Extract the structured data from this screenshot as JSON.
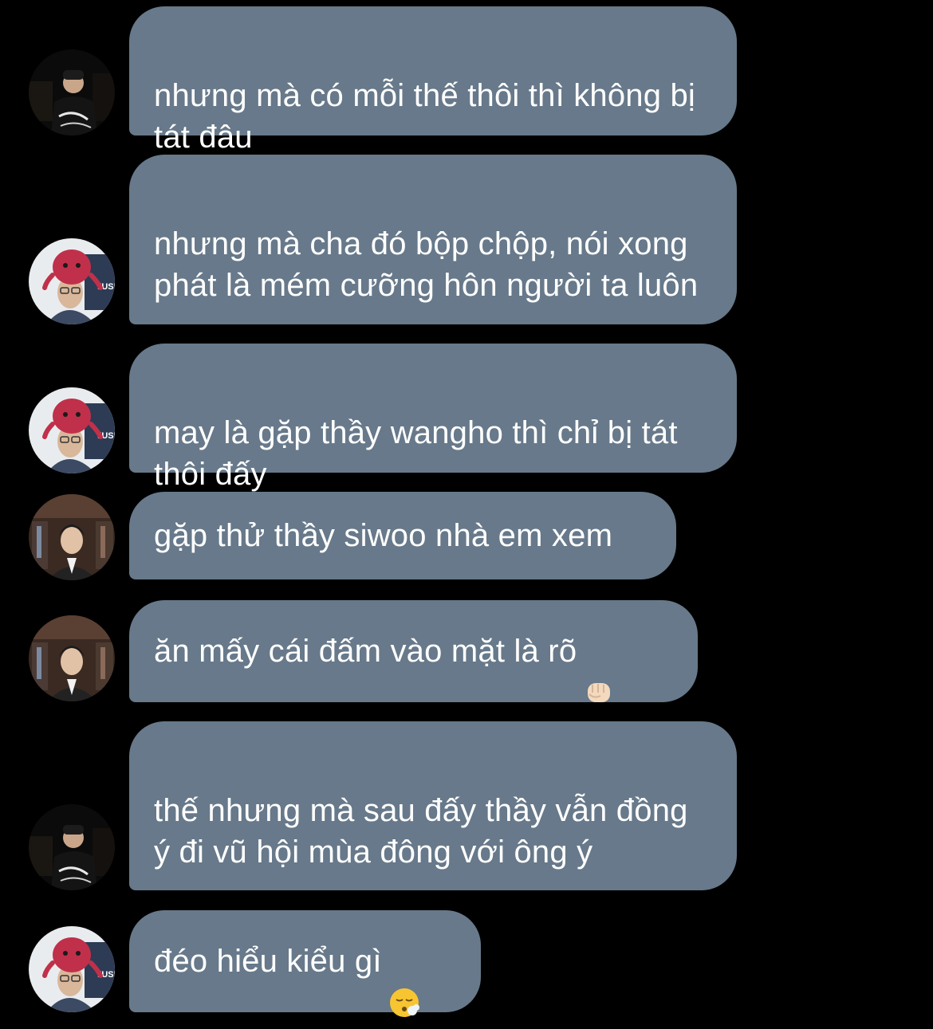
{
  "conversation": {
    "messages": [
      {
        "text": "nhưng mà có mỗi thế thôi thì không bị tát đâu",
        "sender_avatar": "dark-figure-avatar"
      },
      {
        "text": "nhưng mà cha đó bộp chộp, nói xong phát là mém cưỡng hôn người ta luôn",
        "sender_avatar": "octopus-hat-avatar"
      },
      {
        "text": "may là gặp thầy wangho thì chỉ bị tát thôi đấy",
        "sender_avatar": "octopus-hat-avatar"
      },
      {
        "text": "gặp thử thầy siwoo nhà em xem",
        "sender_avatar": "suit-shop-avatar"
      },
      {
        "text": "ăn mấy cái đấm vào mặt là rõ",
        "emoji": "fist-emoji",
        "sender_avatar": "suit-shop-avatar"
      },
      {
        "text": "thế nhưng mà sau đấy thầy vẫn đồng ý đi vũ hội mùa đông với ông ý",
        "sender_avatar": "dark-figure-avatar"
      },
      {
        "text": "đéo hiểu kiểu gì",
        "emoji": "sighing-face-emoji",
        "sender_avatar": "octopus-hat-avatar"
      }
    ]
  },
  "colors": {
    "background": "#000000",
    "bubble": "#67798a",
    "text": "#ffffff"
  }
}
